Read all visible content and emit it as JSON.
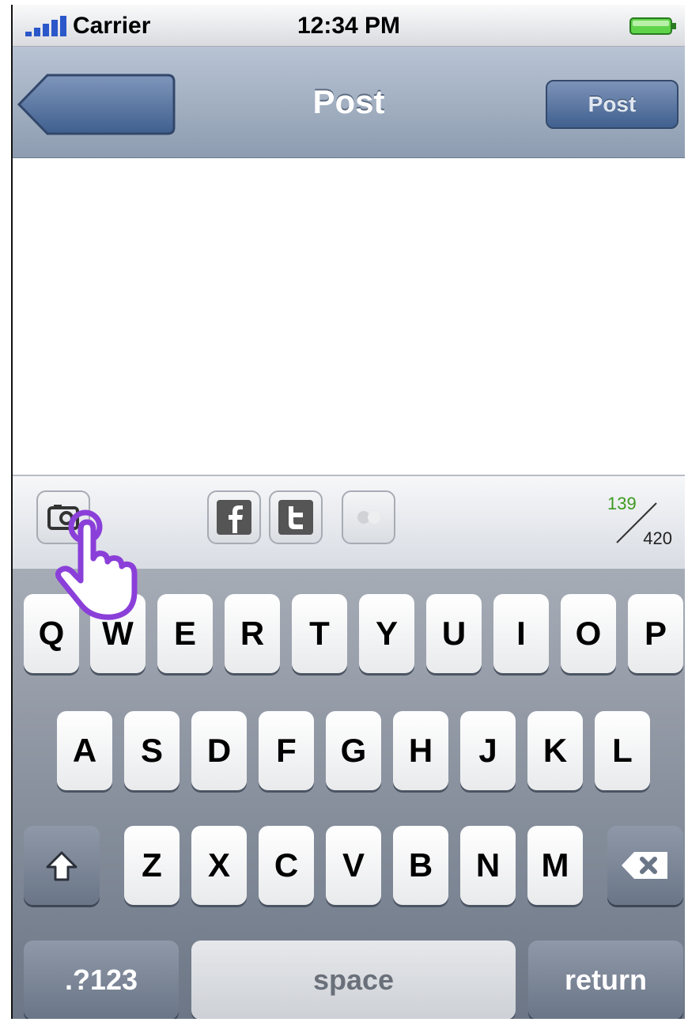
{
  "status_bar": {
    "carrier": "Carrier",
    "time": "12:34 PM"
  },
  "nav": {
    "title": "Post",
    "post_button": "Post"
  },
  "toolbar": {
    "char_count_used": "139",
    "char_count_max": "420"
  },
  "keyboard": {
    "row1": [
      "Q",
      "W",
      "E",
      "R",
      "T",
      "Y",
      "U",
      "I",
      "O",
      "P"
    ],
    "row2": [
      "A",
      "S",
      "D",
      "F",
      "G",
      "H",
      "J",
      "K",
      "L"
    ],
    "row3": [
      "Z",
      "X",
      "C",
      "V",
      "B",
      "N",
      "M"
    ],
    "numbers_key": ".?123",
    "space_key": "space",
    "return_key": "return"
  },
  "icons": [
    "signal-icon",
    "battery-icon",
    "back-arrow",
    "camera-icon",
    "facebook-icon",
    "twitter-icon",
    "flickr-icon",
    "shift-icon",
    "delete-icon",
    "hand-pointer-icon"
  ],
  "colors": {
    "nav_blue": "#4a6a9a",
    "count_green": "#3d9a1f"
  }
}
